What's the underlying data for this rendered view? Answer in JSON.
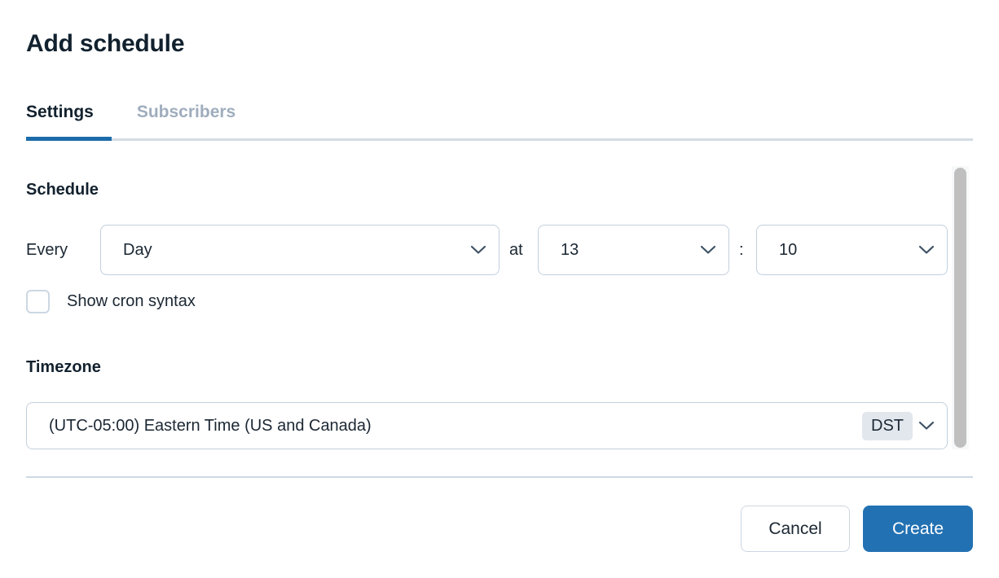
{
  "dialog": {
    "title": "Add schedule"
  },
  "tabs": [
    {
      "label": "Settings",
      "active": true
    },
    {
      "label": "Subscribers",
      "active": false
    }
  ],
  "settings": {
    "schedule": {
      "section_label": "Schedule",
      "every_label": "Every",
      "frequency_value": "Day",
      "at_label": "at",
      "hour_value": "13",
      "colon_label": ":",
      "minute_value": "10",
      "cron_checkbox_label": "Show cron syntax",
      "cron_checkbox_checked": false
    },
    "timezone": {
      "section_label": "Timezone",
      "value": "(UTC-05:00) Eastern Time (US and Canada)",
      "dst_badge": "DST"
    }
  },
  "footer": {
    "cancel_label": "Cancel",
    "create_label": "Create"
  },
  "icons": {
    "chevron_down": "chevron-down-icon",
    "scrollbar": "vertical-scrollbar"
  },
  "colors": {
    "accent": "#1c6cab",
    "primary_button": "#2271b3",
    "border": "#c3d0dd",
    "divider": "#ced8e3",
    "inactive_tab_text": "#9fadbd",
    "badge_bg": "#e2e7ed",
    "text": "#1b2733",
    "scrollbar_thumb": "#bfbfbf"
  }
}
